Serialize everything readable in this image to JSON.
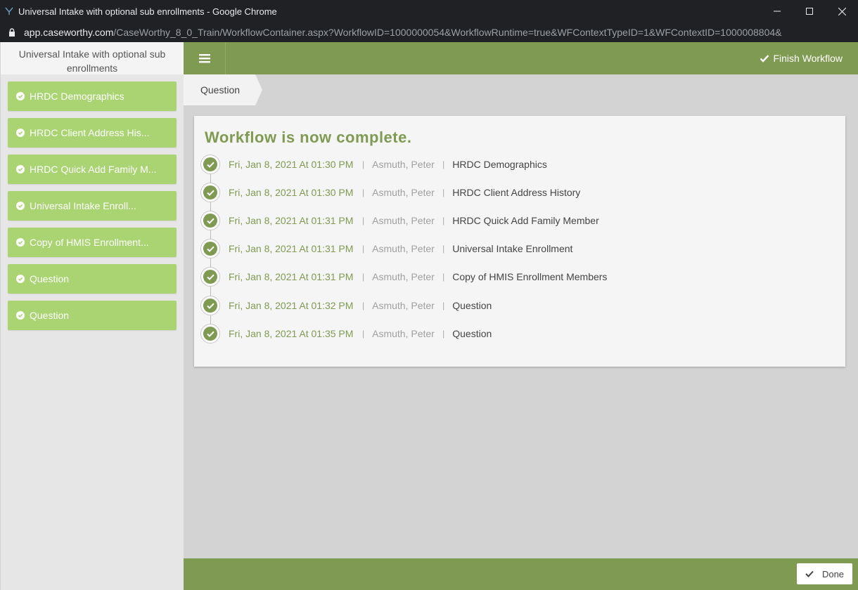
{
  "window": {
    "title": "Universal Intake with optional sub enrollments - Google Chrome",
    "url_host": "app.caseworthy.com",
    "url_path": "/CaseWorthy_8_0_Train/WorkflowContainer.aspx?WorkflowID=1000000054&WorkflowRuntime=true&WFContextTypeID=1&WFContextID=1000008804&"
  },
  "sidebar": {
    "title": "Universal Intake with optional sub enrollments",
    "items": [
      {
        "label": "HRDC Demographics"
      },
      {
        "label": "HRDC Client Address His..."
      },
      {
        "label": "HRDC Quick Add Family M..."
      },
      {
        "label": "Universal Intake Enroll..."
      },
      {
        "label": "Copy of HMIS Enrollment..."
      },
      {
        "label": "Question"
      },
      {
        "label": "Question"
      }
    ]
  },
  "topbar": {
    "finish_label": "Finish Workflow"
  },
  "breadcrumb": {
    "current": "Question"
  },
  "main": {
    "heading": "Workflow is now complete.",
    "separator": "|",
    "timeline": [
      {
        "date": "Fri, Jan 8, 2021 At 01:30 PM",
        "user": "Asmuth, Peter",
        "name": "HRDC Demographics"
      },
      {
        "date": "Fri, Jan 8, 2021 At 01:30 PM",
        "user": "Asmuth, Peter",
        "name": "HRDC Client Address History"
      },
      {
        "date": "Fri, Jan 8, 2021 At 01:31 PM",
        "user": "Asmuth, Peter",
        "name": "HRDC Quick Add Family Member"
      },
      {
        "date": "Fri, Jan 8, 2021 At 01:31 PM",
        "user": "Asmuth, Peter",
        "name": "Universal Intake Enrollment"
      },
      {
        "date": "Fri, Jan 8, 2021 At 01:31 PM",
        "user": "Asmuth, Peter",
        "name": "Copy of HMIS Enrollment Members"
      },
      {
        "date": "Fri, Jan 8, 2021 At 01:32 PM",
        "user": "Asmuth, Peter",
        "name": "Question"
      },
      {
        "date": "Fri, Jan 8, 2021 At 01:35 PM",
        "user": "Asmuth, Peter",
        "name": "Question"
      }
    ]
  },
  "footer": {
    "done_label": "Done"
  },
  "colors": {
    "accent": "#7f9b51",
    "sidebar_item": "#a9d471"
  },
  "icons": {
    "app": "caseworthy-logo-icon",
    "lock": "lock-icon",
    "menu": "hamburger-menu-icon",
    "finish": "check-icon",
    "step": "check-circle-icon",
    "done": "check-icon"
  }
}
